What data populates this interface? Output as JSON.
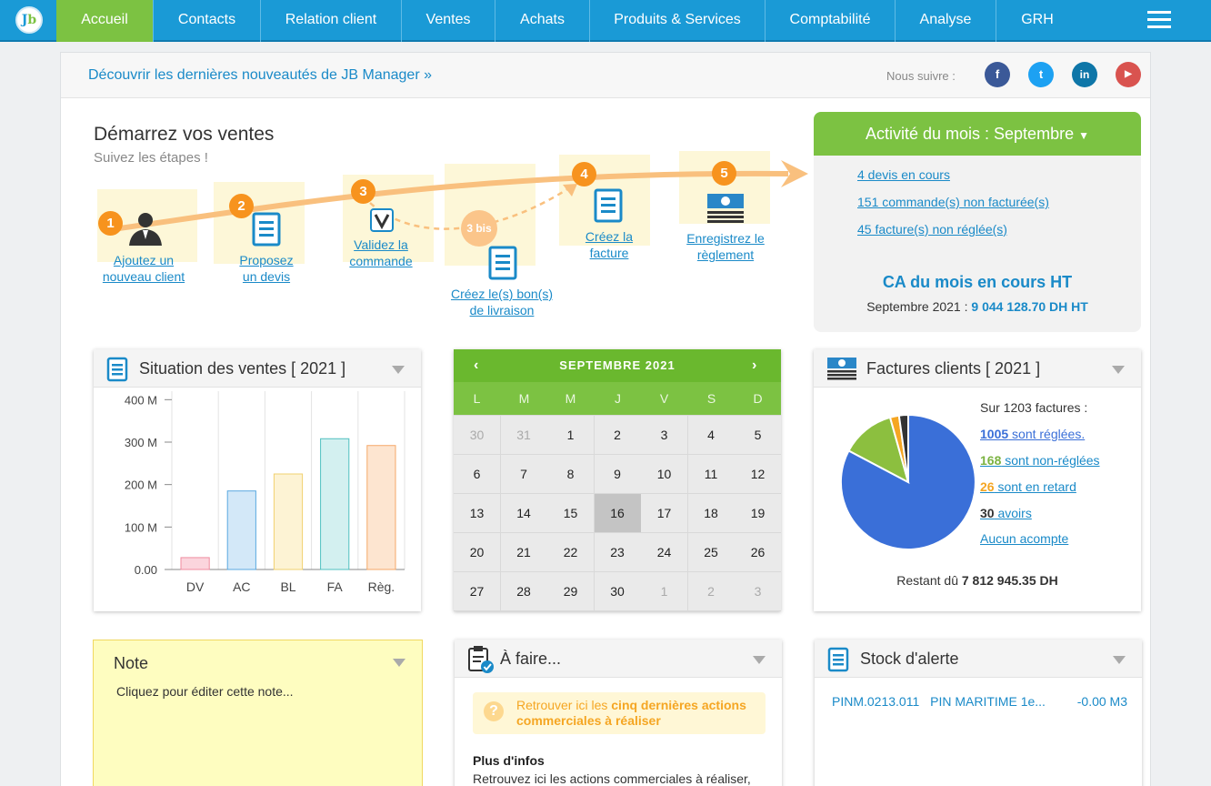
{
  "nav": {
    "logo_j": "J",
    "logo_b": "b",
    "items": [
      "Accueil",
      "Contacts",
      "Relation client",
      "Ventes",
      "Achats",
      "Produits & Services",
      "Comptabilité",
      "Analyse",
      "GRH"
    ]
  },
  "topbar": {
    "news": "Découvrir les dernières nouveautés de JB Manager »",
    "follow": "Nous suivre :"
  },
  "steps": {
    "title": "Démarrez vos ventes",
    "subtitle": "Suivez les étapes !",
    "items": [
      {
        "num": "1",
        "label1": "Ajoutez un",
        "label2": "nouveau client"
      },
      {
        "num": "2",
        "label1": "Proposez",
        "label2": "un devis"
      },
      {
        "num": "3",
        "label1": "Validez la",
        "label2": "commande"
      },
      {
        "num": "3 bis",
        "label1": "Créez le(s) bon(s)",
        "label2": "de livraison"
      },
      {
        "num": "4",
        "label1": "Créez la",
        "label2": "facture"
      },
      {
        "num": "5",
        "label1": "Enregistrez le",
        "label2": "règlement"
      }
    ]
  },
  "activity": {
    "title": "Activité du mois : Septembre",
    "links": [
      "4 devis en cours",
      "151 commande(s) non facturée(s)",
      "45 facture(s) non réglée(s)"
    ],
    "ca_title": "CA du mois en cours HT",
    "ca_label": "Septembre 2021 : ",
    "ca_value": "9 044 128.70 DH HT"
  },
  "sales": {
    "title": "Situation des ventes [ 2021 ]"
  },
  "chart_data": {
    "type": "bar",
    "categories": [
      "DV",
      "AC",
      "BL",
      "FA",
      "Règ."
    ],
    "values": [
      28,
      185,
      225,
      308,
      292
    ],
    "ylim": [
      0,
      420
    ],
    "yticks": [
      "0.00",
      "100 M",
      "200 M",
      "300 M",
      "400 M"
    ],
    "yticks_values": [
      0,
      100,
      200,
      300,
      400
    ],
    "colors": {
      "fill": [
        "#fbd5dd",
        "#d3e8f8",
        "#fdf3d4",
        "#d3f0f0",
        "#fde5d0"
      ],
      "stroke": [
        "#f08ca0",
        "#5ba9e0",
        "#f0d070",
        "#4fc0c0",
        "#f5a868"
      ]
    },
    "grid": true
  },
  "calendar": {
    "title": "SEPTEMBRE 2021",
    "prev": "‹",
    "next": "›",
    "days": [
      "L",
      "M",
      "M",
      "J",
      "V",
      "S",
      "D"
    ],
    "weeks": [
      [
        "30",
        "31",
        "1",
        "2",
        "3",
        "4",
        "5"
      ],
      [
        "6",
        "7",
        "8",
        "9",
        "10",
        "11",
        "12"
      ],
      [
        "13",
        "14",
        "15",
        "16",
        "17",
        "18",
        "19"
      ],
      [
        "20",
        "21",
        "22",
        "23",
        "24",
        "25",
        "26"
      ],
      [
        "27",
        "28",
        "29",
        "30",
        "1",
        "2",
        "3"
      ]
    ],
    "today": "16"
  },
  "invoices": {
    "title": "Factures clients [ 2021 ]",
    "total": "Sur 1203 factures :",
    "items": [
      {
        "n": "1005",
        "t": " sont réglées.",
        "c": "#3a6fd8"
      },
      {
        "n": "168",
        "t": " sont non-réglées",
        "c": "#7cb342"
      },
      {
        "n": "26",
        "t": " sont en retard",
        "c": "#f5a623"
      },
      {
        "n": "30",
        "t": " avoirs",
        "c": "#333333"
      }
    ],
    "no_deposit": "Aucun acompte",
    "remaining_label": "Restant dû ",
    "remaining_value": "7 812 945.35 DH"
  },
  "note": {
    "title": "Note",
    "text": "Cliquez pour éditer cette note..."
  },
  "todo": {
    "title": "À faire...",
    "msg1": "Retrouver ici les ",
    "msg2": "cinq dernières actions",
    "msg3": "commerciales à réaliser",
    "more_title": "Plus d'infos",
    "more_text": "Retrouvez ici les actions commerciales à réaliser,"
  },
  "stock": {
    "title": "Stock d'alerte",
    "row": {
      "code": "PINM.0213.011",
      "name": "PIN MARITIME 1e...",
      "qty": "-0.00 M3"
    }
  }
}
